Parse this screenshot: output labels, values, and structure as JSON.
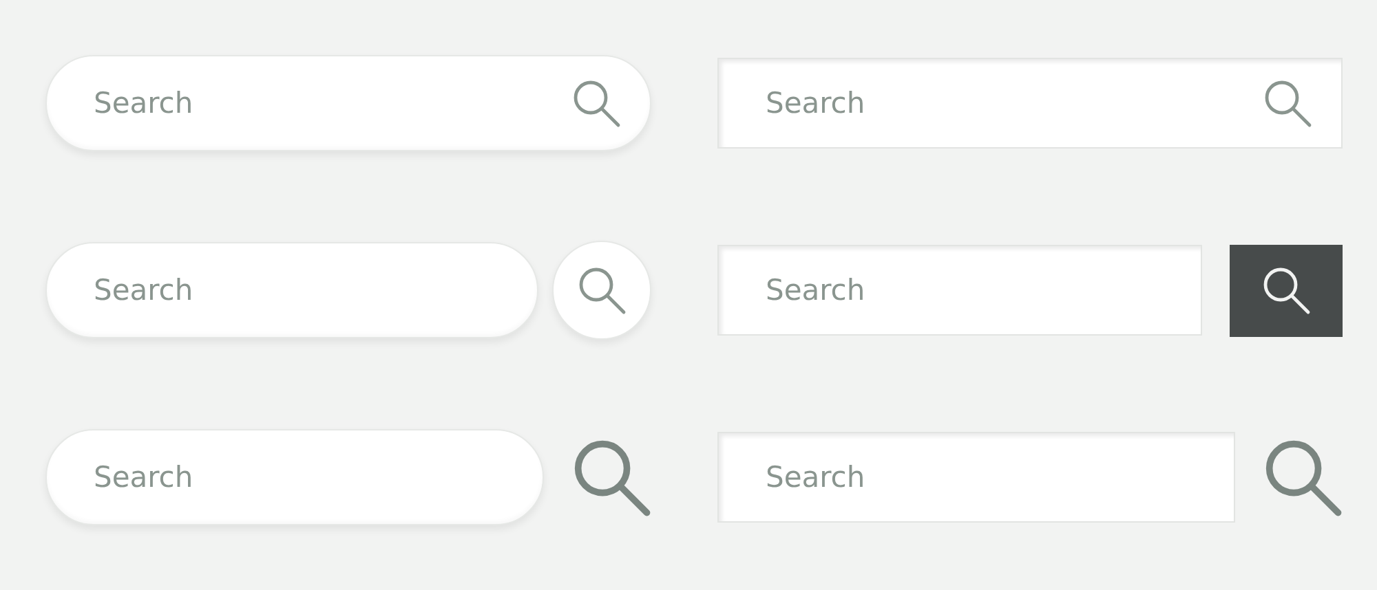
{
  "search_bars": [
    {
      "rounded": true,
      "kind": "inset-icon",
      "placeholder": "Search"
    },
    {
      "rounded": false,
      "kind": "inset-icon",
      "placeholder": "Search"
    },
    {
      "rounded": true,
      "kind": "circle-button",
      "placeholder": "Search"
    },
    {
      "rounded": false,
      "kind": "square-button",
      "placeholder": "Search"
    },
    {
      "rounded": true,
      "kind": "plain-icon",
      "placeholder": "Search"
    },
    {
      "rounded": false,
      "kind": "plain-icon",
      "placeholder": "Search"
    }
  ]
}
